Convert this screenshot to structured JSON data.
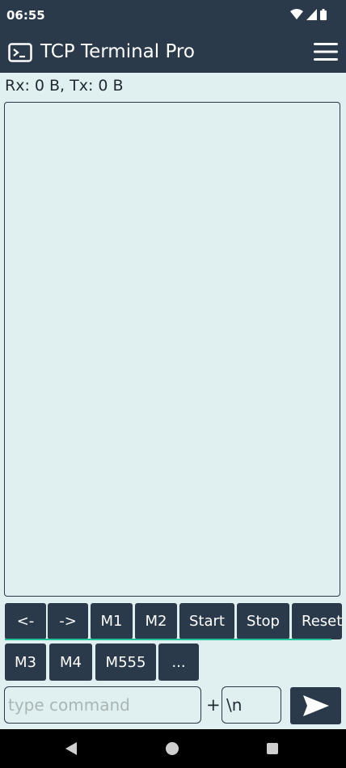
{
  "status_bar": {
    "time": "06:55",
    "icons": [
      "wifi-icon",
      "cell-signal-icon",
      "battery-icon"
    ]
  },
  "app_bar": {
    "title": "TCP Terminal Pro",
    "icons": [
      "terminal-icon",
      "hamburger-menu-icon"
    ]
  },
  "stats": {
    "text": "Rx: 0 B, Tx: 0 B"
  },
  "macro_row_1": [
    "<-",
    "->",
    "M1",
    "M2",
    "Start",
    "Stop",
    "Reset"
  ],
  "macro_row_2": [
    "M3",
    "M4",
    "M555",
    "..."
  ],
  "command": {
    "placeholder": "type command",
    "value": "",
    "plus": "+",
    "suffix_value": "\\n"
  },
  "nav_bar": {
    "icons": [
      "back-icon",
      "home-icon",
      "recents-icon"
    ]
  },
  "colors": {
    "bar_background": "#2b3a4a",
    "page_background": "#e0efef",
    "scroll_accent": "#22c29a"
  }
}
